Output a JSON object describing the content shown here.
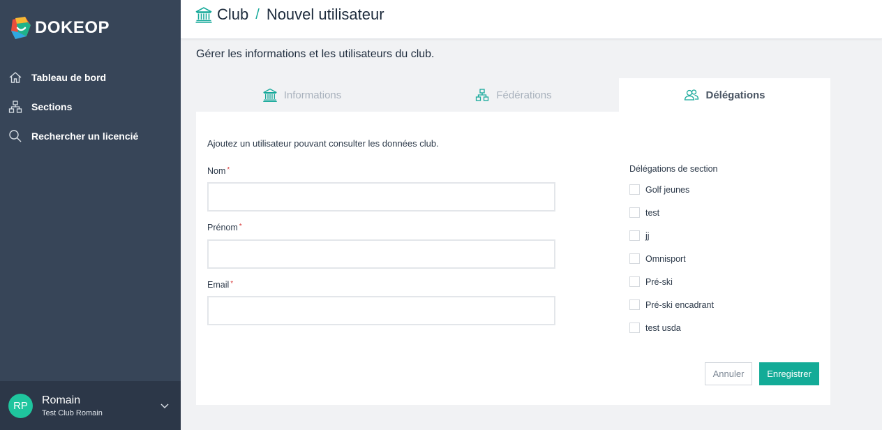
{
  "brand": {
    "name": "DOKEOP",
    "accent": "#16a99a",
    "sidebar_bg": "#374558"
  },
  "sidebar": {
    "items": [
      {
        "label": "Tableau de bord",
        "icon": "home-icon"
      },
      {
        "label": "Sections",
        "icon": "sitemap-icon"
      },
      {
        "label": "Rechercher un licencié",
        "icon": "search-icon"
      }
    ]
  },
  "user": {
    "initials": "RP",
    "name": "Romain",
    "club": "Test Club Romain"
  },
  "header": {
    "section": "Club",
    "separator": "/",
    "page": "Nouvel utilisateur"
  },
  "subtitle": "Gérer les informations et les utilisateurs du club.",
  "tabs": [
    {
      "label": "Informations",
      "icon": "bank-icon",
      "active": false
    },
    {
      "label": "Fédérations",
      "icon": "sitemap-icon",
      "active": false
    },
    {
      "label": "Délégations",
      "icon": "users-icon",
      "active": true
    }
  ],
  "form": {
    "intro": "Ajoutez un utilisateur pouvant consulter les données club.",
    "fields": [
      {
        "label": "Nom",
        "required_mark": "*",
        "value": ""
      },
      {
        "label": "Prénom",
        "required_mark": "*",
        "value": ""
      },
      {
        "label": "Email",
        "required_mark": "*",
        "value": ""
      }
    ],
    "delegations_title": "Délégations de section",
    "delegations": [
      {
        "label": "Golf jeunes",
        "checked": false
      },
      {
        "label": "test",
        "checked": false
      },
      {
        "label": "jj",
        "checked": false
      },
      {
        "label": "Omnisport",
        "checked": false
      },
      {
        "label": "Pré-ski",
        "checked": false
      },
      {
        "label": "Pré-ski encadrant",
        "checked": false
      },
      {
        "label": "test usda",
        "checked": false
      }
    ],
    "cancel_label": "Annuler",
    "save_label": "Enregistrer"
  }
}
